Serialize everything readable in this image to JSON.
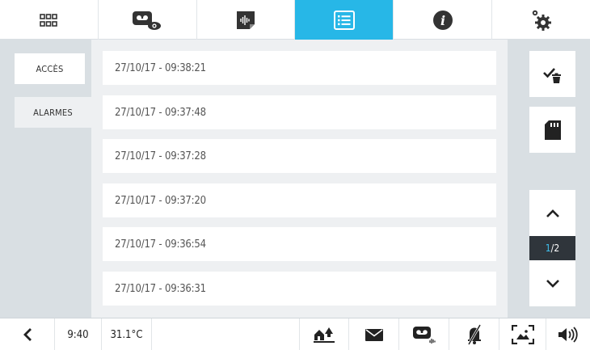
{
  "top_tabs": [
    {
      "name": "apps-grid",
      "icon": "grid-icon"
    },
    {
      "name": "video-memory",
      "icon": "video-eye-icon"
    },
    {
      "name": "audio-message",
      "icon": "audio-note-icon"
    },
    {
      "name": "event-list",
      "icon": "list-icon",
      "active": true
    },
    {
      "name": "information",
      "icon": "info-icon"
    },
    {
      "name": "settings",
      "icon": "gear-icon"
    }
  ],
  "sidebar": {
    "items": [
      {
        "label": "ACCÈS",
        "selected": false
      },
      {
        "label": "ALARMES",
        "selected": true
      }
    ]
  },
  "events": [
    "27/10/17 - 09:38:21",
    "27/10/17 - 09:37:48",
    "27/10/17 - 09:37:28",
    "27/10/17 - 09:37:20",
    "27/10/17 - 09:36:54",
    "27/10/17 - 09:36:31"
  ],
  "actions": {
    "delete_checked_icon": "check-trash-icon",
    "sd_card_icon": "sd-card-icon"
  },
  "pager": {
    "current": "1",
    "separator": "/",
    "total": "2"
  },
  "status_bar": {
    "time": "9:40",
    "temperature": "31.1°C"
  },
  "status_icons": [
    "back-icon",
    "home-away-icon",
    "mail-icon",
    "video-message-icon",
    "mute-bell-icon",
    "picture-frame-icon",
    "volume-icon"
  ],
  "colors": {
    "accent": "#27b7e7",
    "panel": "#d9dfe3",
    "pager_indicator": "#2f353b"
  }
}
